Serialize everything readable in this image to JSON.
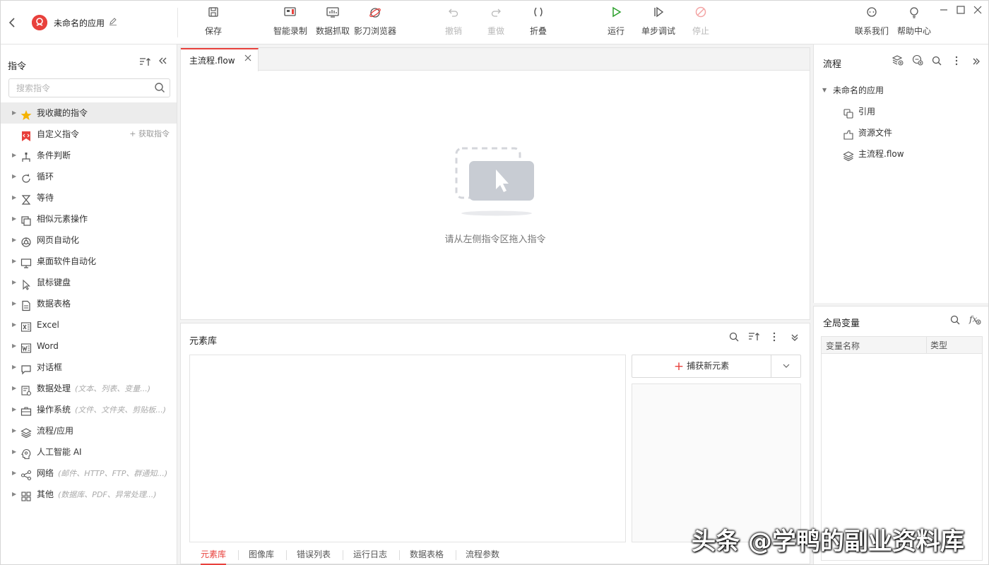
{
  "app": {
    "title": "未命名的应用",
    "accent_color": "#e8413c"
  },
  "toolbar": {
    "tools": [
      {
        "label": "保存",
        "icon": "save-icon"
      },
      {
        "label": "智能录制",
        "icon": "record-icon"
      },
      {
        "label": "数据抓取",
        "icon": "data-scrape-icon"
      },
      {
        "label": "影刀浏览器",
        "icon": "browser-icon"
      },
      {
        "label": "撤销",
        "icon": "undo-icon",
        "disabled": true
      },
      {
        "label": "重做",
        "icon": "redo-icon",
        "disabled": true
      },
      {
        "label": "折叠",
        "icon": "fold-icon"
      },
      {
        "label": "运行",
        "icon": "play-icon"
      },
      {
        "label": "单步调试",
        "icon": "step-debug-icon"
      },
      {
        "label": "停止",
        "icon": "stop-icon",
        "disabled": true
      },
      {
        "label": "联系我们",
        "icon": "contact-icon"
      },
      {
        "label": "帮助中心",
        "icon": "help-icon"
      }
    ]
  },
  "commands": {
    "title": "指令",
    "search_placeholder": "搜索指令",
    "get_commands_label": "获取指令",
    "items": [
      {
        "label": "我收藏的指令",
        "icon": "star-icon",
        "hint": ""
      },
      {
        "label": "自定义指令",
        "icon": "custom-command-icon",
        "hint": ""
      },
      {
        "label": "条件判断",
        "icon": "branch-icon",
        "hint": ""
      },
      {
        "label": "循环",
        "icon": "loop-icon",
        "hint": ""
      },
      {
        "label": "等待",
        "icon": "hourglass-icon",
        "hint": ""
      },
      {
        "label": "相似元素操作",
        "icon": "similar-elements-icon",
        "hint": ""
      },
      {
        "label": "网页自动化",
        "icon": "web-icon",
        "hint": ""
      },
      {
        "label": "桌面软件自动化",
        "icon": "desktop-icon",
        "hint": ""
      },
      {
        "label": "鼠标键盘",
        "icon": "cursor-icon",
        "hint": ""
      },
      {
        "label": "数据表格",
        "icon": "data-table-icon",
        "hint": ""
      },
      {
        "label": "Excel",
        "icon": "excel-icon",
        "hint": ""
      },
      {
        "label": "Word",
        "icon": "word-icon",
        "hint": ""
      },
      {
        "label": "对话框",
        "icon": "dialog-icon",
        "hint": ""
      },
      {
        "label": "数据处理",
        "icon": "data-processing-icon",
        "hint": "(文本、列表、变量...)"
      },
      {
        "label": "操作系统",
        "icon": "os-icon",
        "hint": "(文件、文件夹、剪贴板...)"
      },
      {
        "label": "流程/应用",
        "icon": "layers-icon",
        "hint": ""
      },
      {
        "label": "人工智能 AI",
        "icon": "ai-icon",
        "hint": ""
      },
      {
        "label": "网络",
        "icon": "network-icon",
        "hint": "(邮件、HTTP、FTP、群通知...)"
      },
      {
        "label": "其他",
        "icon": "grid-icon",
        "hint": "(数据库、PDF、异常处理...)"
      }
    ]
  },
  "editor": {
    "tab_label": "主流程.flow",
    "empty_message": "请从左侧指令区拖入指令"
  },
  "element_library": {
    "title": "元素库",
    "capture_label": "捕获新元素",
    "bottom_tabs": [
      "元素库",
      "图像库",
      "错误列表",
      "运行日志",
      "数据表格",
      "流程参数"
    ]
  },
  "process_panel": {
    "title": "流程",
    "root": "未命名的应用",
    "children": [
      {
        "label": "引用",
        "icon": "reference-icon"
      },
      {
        "label": "资源文件",
        "icon": "resource-file-icon"
      },
      {
        "label": "主流程.flow",
        "icon": "layers-icon"
      }
    ]
  },
  "variables": {
    "title": "全局变量",
    "col_name": "变量名称",
    "col_type": "类型"
  },
  "watermark": "头条 @学鸭的副业资料库"
}
